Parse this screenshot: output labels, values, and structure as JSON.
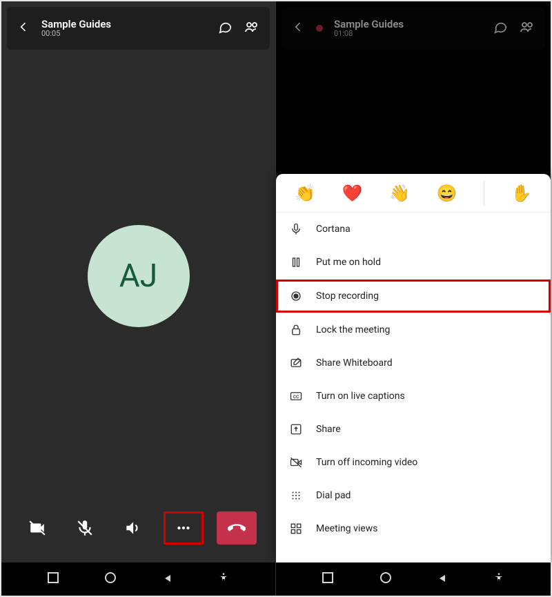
{
  "left": {
    "header": {
      "title": "Sample Guides",
      "timer": "00:05"
    },
    "avatar": "AJ"
  },
  "right": {
    "header": {
      "title": "Sample Guides",
      "timer": "01:08"
    },
    "reactions": [
      "👏",
      "❤️",
      "👋",
      "😄",
      "✋"
    ],
    "menu": [
      {
        "label": "Cortana",
        "icon": "mic"
      },
      {
        "label": "Put me on hold",
        "icon": "pause"
      },
      {
        "label": "Stop recording",
        "icon": "record",
        "highlight": true
      },
      {
        "label": "Lock the meeting",
        "icon": "lock"
      },
      {
        "label": "Share Whiteboard",
        "icon": "whiteboard"
      },
      {
        "label": "Turn on live captions",
        "icon": "cc"
      },
      {
        "label": "Share",
        "icon": "share"
      },
      {
        "label": "Turn off incoming video",
        "icon": "videooff"
      },
      {
        "label": "Dial pad",
        "icon": "dialpad"
      },
      {
        "label": "Meeting views",
        "icon": "views"
      }
    ]
  }
}
